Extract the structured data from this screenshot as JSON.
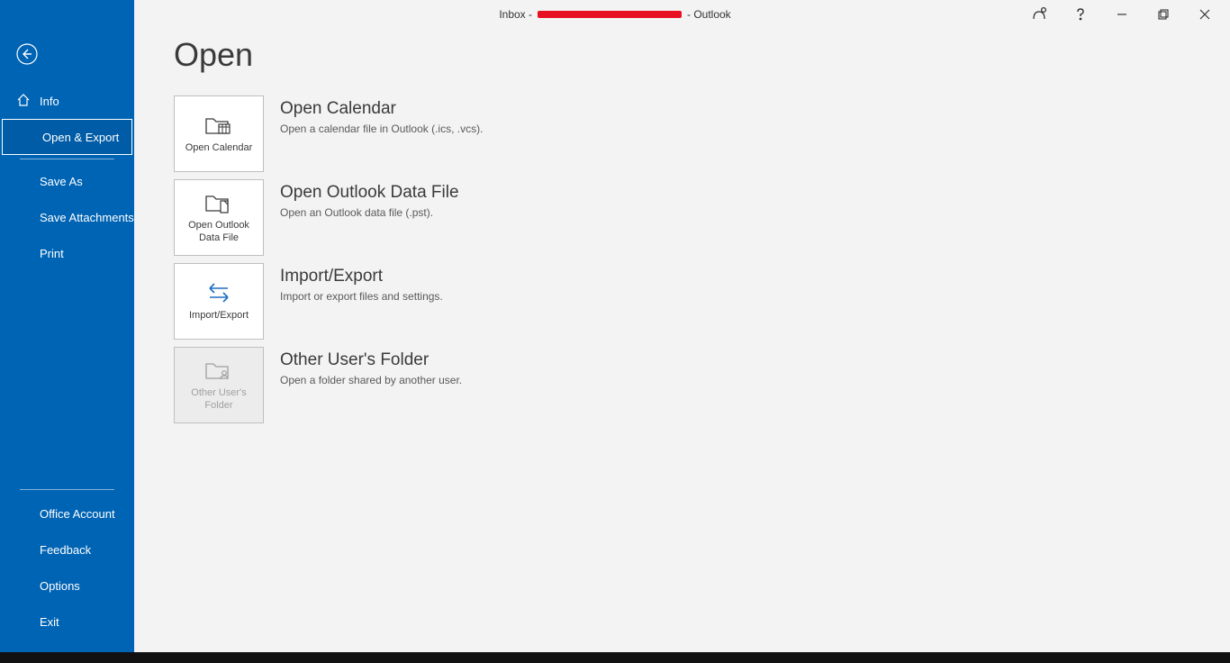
{
  "window": {
    "title_prefix": "Inbox -",
    "title_suffix": "- Outlook"
  },
  "sidebar": {
    "info": "Info",
    "open_export": "Open & Export",
    "save_as": "Save As",
    "save_attachments": "Save Attachments",
    "print": "Print",
    "office_account": "Office Account",
    "feedback": "Feedback",
    "options": "Options",
    "exit": "Exit"
  },
  "page": {
    "title": "Open",
    "items": [
      {
        "tile": "Open Calendar",
        "title": "Open Calendar",
        "desc": "Open a calendar file in Outlook (.ics, .vcs)."
      },
      {
        "tile": "Open Outlook Data File",
        "title": "Open Outlook Data File",
        "desc": "Open an Outlook data file (.pst)."
      },
      {
        "tile": "Import/Export",
        "title": "Import/Export",
        "desc": "Import or export files and settings."
      },
      {
        "tile": "Other User's Folder",
        "title": "Other User's Folder",
        "desc": "Open a folder shared by another user."
      }
    ]
  }
}
